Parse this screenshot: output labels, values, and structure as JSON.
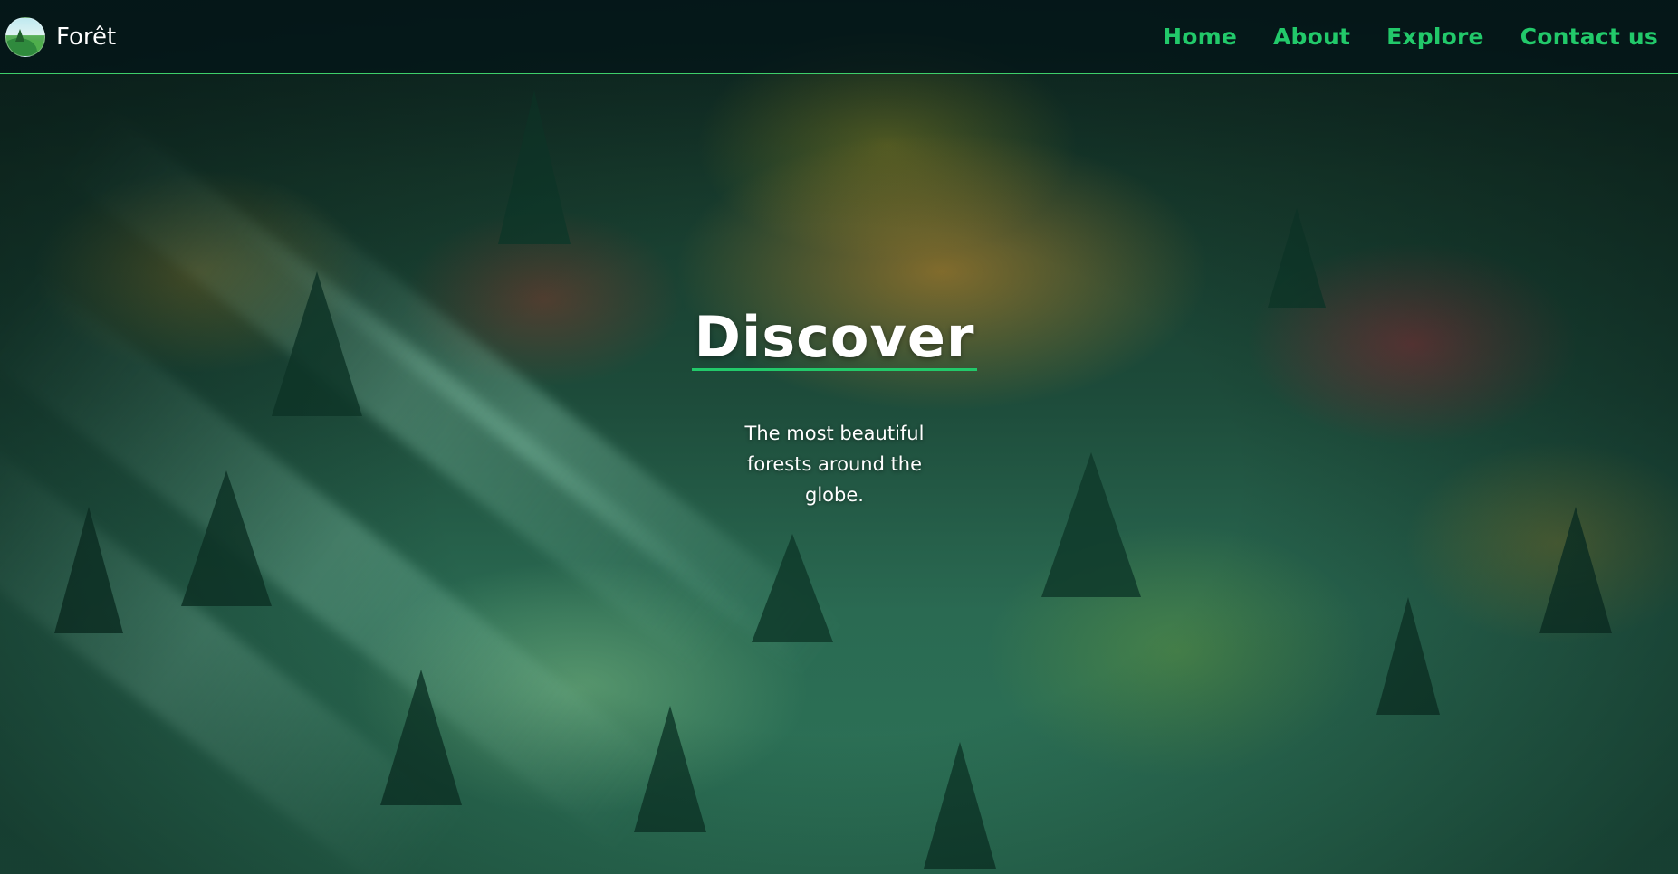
{
  "brand": {
    "name": "Forêt",
    "logo_icon": "forest-landscape-icon"
  },
  "nav": {
    "items": [
      {
        "label": "Home"
      },
      {
        "label": "About"
      },
      {
        "label": "Explore"
      },
      {
        "label": "Contact us"
      }
    ]
  },
  "hero": {
    "title": "Discover",
    "subtitle": "The most beautiful forests around the globe."
  },
  "colors": {
    "accent": "#22c96a",
    "nav_bg": "#04161899",
    "text": "#ffffff"
  }
}
